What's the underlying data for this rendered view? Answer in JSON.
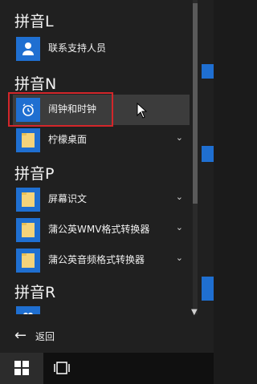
{
  "start_menu": {
    "groups": [
      {
        "header": "拼音L",
        "apps": [
          {
            "label": "联系支持人员",
            "icon": "person-icon",
            "has_chevron": false
          }
        ]
      },
      {
        "header": "拼音N",
        "apps": [
          {
            "label": "闹钟和时钟",
            "icon": "alarm-clock-icon",
            "has_chevron": false,
            "selected": true
          },
          {
            "label": "柠檬桌面",
            "icon": "folder-icon",
            "has_chevron": true
          }
        ]
      },
      {
        "header": "拼音P",
        "apps": [
          {
            "label": "屏幕识文",
            "icon": "folder-icon",
            "has_chevron": true
          },
          {
            "label": "蒲公英WMV格式转换器",
            "icon": "folder-icon",
            "has_chevron": true
          },
          {
            "label": "蒲公英音频格式转换器",
            "icon": "folder-icon",
            "has_chevron": true
          }
        ]
      },
      {
        "header": "拼音R",
        "apps": [
          {
            "label": "",
            "icon": "people-icon",
            "has_chevron": false
          }
        ]
      }
    ],
    "back_label": "返回",
    "chevron_glyph": "⌄"
  },
  "colors": {
    "tile_blue": "#1f6fd1",
    "highlight_red": "#d3262a",
    "panel": "#202020"
  }
}
